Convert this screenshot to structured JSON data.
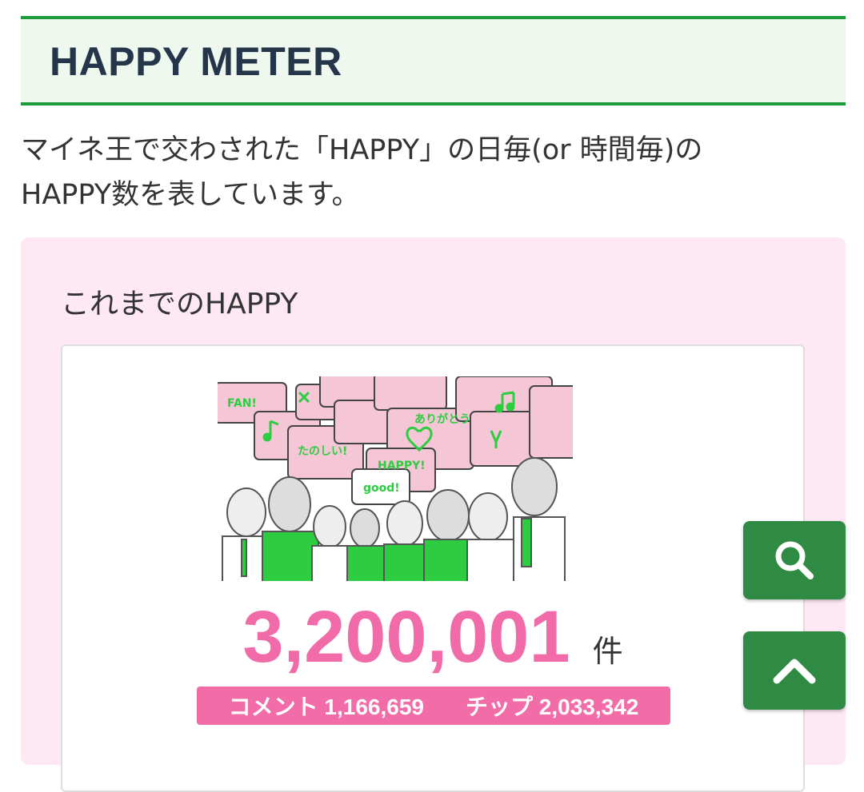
{
  "header": {
    "title": "HAPPY METER"
  },
  "description": {
    "line1": "マイネ王で交わされた「HAPPY」の日毎(or 時間毎)の",
    "line2": "HAPPY数を表しています。"
  },
  "panel": {
    "title": "これまでのHAPPY",
    "total_count": "3,200,001",
    "unit": "件",
    "comments_label": "コメント",
    "comments_value": "1,166,659",
    "tips_label": "チップ",
    "tips_value": "2,033,342"
  },
  "illustration": {
    "bubble_texts": [
      "FAN!",
      "ありがとう",
      "たのしい!",
      "HAPPY!",
      "good!"
    ]
  },
  "buttons": {
    "search_icon": "search-icon",
    "top_icon": "chevron-up-icon"
  },
  "colors": {
    "brand_green": "#1e9c3a",
    "happy_pink": "#f06ba8",
    "fab_green": "#2f8a43",
    "panel_bg": "#fde8f3"
  }
}
